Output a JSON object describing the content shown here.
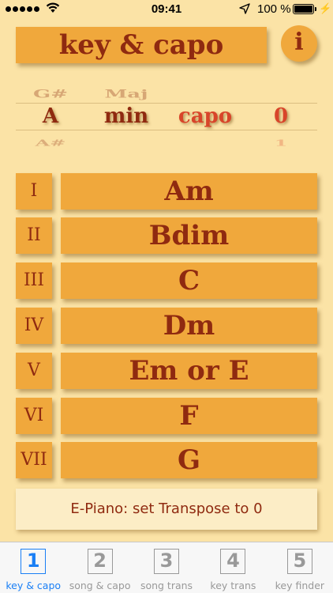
{
  "status_bar": {
    "time": "09:41",
    "battery_pct": "100 %",
    "battery_level": 1.0,
    "signal_dots": 5
  },
  "header": {
    "title": "key & capo",
    "info_label": "i"
  },
  "picker": {
    "key": {
      "above": "G#",
      "selected": "A",
      "below": "A#"
    },
    "mode": {
      "above": "Maj",
      "selected": "min"
    },
    "capo_label": "capo",
    "capo": {
      "selected": "0",
      "below": "1"
    }
  },
  "chords": [
    {
      "numeral": "I",
      "chord": "Am"
    },
    {
      "numeral": "II",
      "chord": "Bdim"
    },
    {
      "numeral": "III",
      "chord": "C"
    },
    {
      "numeral": "IV",
      "chord": "Dm"
    },
    {
      "numeral": "V",
      "chord": "Em or E"
    },
    {
      "numeral": "VI",
      "chord": "F"
    },
    {
      "numeral": "VII",
      "chord": "G"
    }
  ],
  "note": "E-Piano: set Transpose to 0",
  "tabs": [
    {
      "number": "1",
      "label": "key & capo",
      "active": true
    },
    {
      "number": "2",
      "label": "song & capo",
      "active": false
    },
    {
      "number": "3",
      "label": "song trans",
      "active": false
    },
    {
      "number": "4",
      "label": "key trans",
      "active": false
    },
    {
      "number": "5",
      "label": "key finder",
      "active": false
    }
  ],
  "colors": {
    "background": "#fbe3a6",
    "button": "#f0a83c",
    "text": "#8f2a10",
    "capo_accent": "#d8452a",
    "tab_active": "#1a7ff5"
  }
}
